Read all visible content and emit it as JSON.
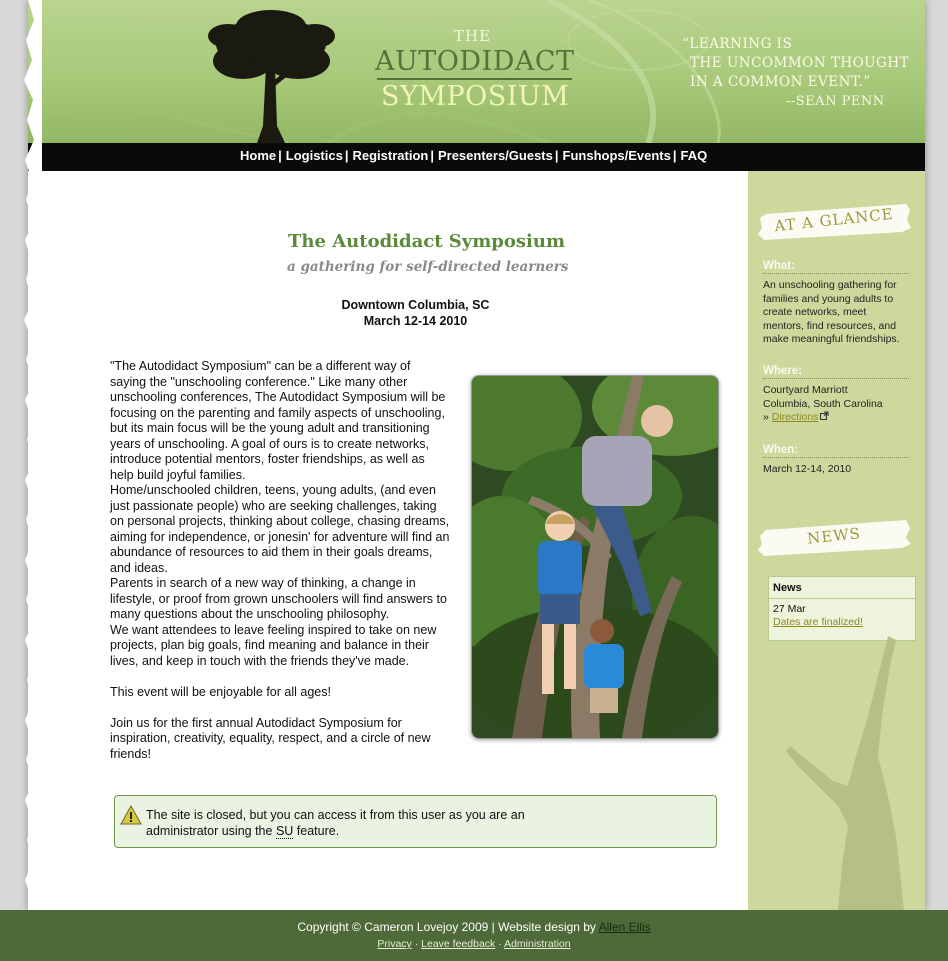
{
  "header": {
    "logo_the": "THE",
    "logo_line1": "AUTODIDACT",
    "logo_line2": "SYMPOSIUM",
    "quote_line1": "“LEARNING IS",
    "quote_line2": "THE UNCOMMON THOUGHT",
    "quote_line3": "IN A COMMON EVENT.”",
    "quote_author": "--SEAN PENN"
  },
  "nav": {
    "items": [
      {
        "label": "Home"
      },
      {
        "label": "Logistics"
      },
      {
        "label": "Registration"
      },
      {
        "label": "Presenters/Guests"
      },
      {
        "label": "Funshops/Events"
      },
      {
        "label": "FAQ"
      }
    ],
    "separator": "|"
  },
  "main": {
    "title": "The Autodidact Symposium",
    "subtitle": "a gathering for self-directed learners",
    "location": "Downtown Columbia, SC",
    "dates": "March 12-14 2010",
    "paragraph1": " \"The Autodidact Symposium\" can be a different way of saying the \"unschooling conference.\" Like many other unschooling conferences, The Autodidact Symposium will be focusing on the parenting and family aspects of unschooling, but its main focus will be the young adult and transitioning years of unschooling. A goal of ours is to create networks, introduce potential mentors, foster friendships, as well as help build joyful families.",
    "paragraph2": "Home/unschooled children, teens, young adults, (and even just passionate people) who are seeking challenges, taking on personal projects, thinking about college, chasing dreams, aiming for independence, or jonesin' for adventure will find an abundance of resources to aid them in their goals dreams, and ideas.",
    "paragraph3": "Parents in search of a new way of thinking, a change in lifestyle, or proof from grown unschoolers will find answers to many questions about the unschooling philosophy.",
    "paragraph4": "We want attendees to leave feeling inspired to take on new projects, plan big goals, find meaning and balance in their lives, and keep in touch with the friends they've made.",
    "paragraph5": "This event will be enjoyable for all ages!",
    "paragraph6": "Join us for the first annual Autodidact Symposium for inspiration, creativity, equality, respect, and a circle of new friends!"
  },
  "message": {
    "text_before": "The site is closed, but you can access it from this user as you are an administrator using the ",
    "abbr": "SU",
    "text_after": " feature."
  },
  "sidebar": {
    "glance_banner": "AT A GLANCE",
    "what_label": "What:",
    "what_text": "An unschooling gathering for families and young adults to create networks, meet mentors, find resources, and make meaningful friendships.",
    "where_label": "Where:",
    "where_line1": "Courtyard Marriott",
    "where_line2": "Columbia, South Carolina",
    "where_prefix": "»",
    "directions_label": "Directions",
    "when_label": "When:",
    "when_text": "March 12-14, 2010",
    "news_banner": "NEWS",
    "news_box_title": "News",
    "news_date": "27 Mar",
    "news_link": "Dates are finalized!"
  },
  "footer": {
    "copyright": "Copyright © Cameron Lovejoy 2009 | Website design by ",
    "designer": "Allen Ellis",
    "links": [
      {
        "label": "Privacy"
      },
      {
        "label": "Leave feedback"
      },
      {
        "label": "Administration"
      }
    ],
    "link_sep": "·"
  }
}
